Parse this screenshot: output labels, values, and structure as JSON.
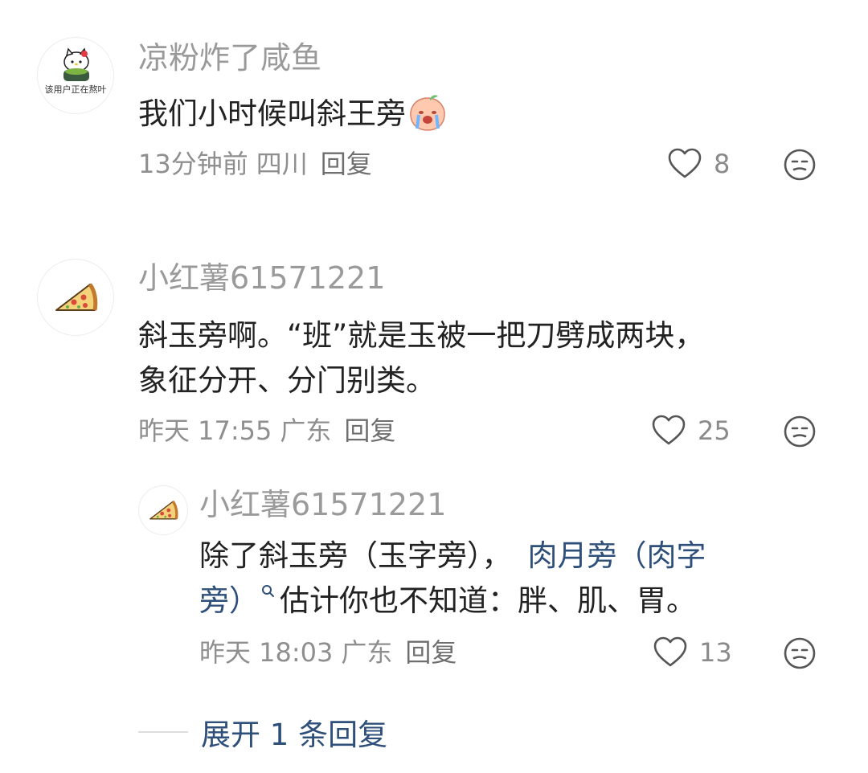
{
  "comments": [
    {
      "avatar_caption": "该用户正在熬叶",
      "username": "凉粉炸了咸鱼",
      "content": "我们小时候叫斜王旁",
      "time": "13分钟前",
      "location": "四川",
      "reply_label": "回复",
      "likes": "8",
      "avatar_icon": "hello-kitty-avatar",
      "emoji_icon": "crying-peach-emoji"
    },
    {
      "username": "小红薯61571221",
      "content_line1": "斜玉旁啊。“班”就是玉被一把刀劈成两块，",
      "content_line2": "象征分开、分门别类。",
      "time": "昨天 17:55",
      "location": "广东",
      "reply_label": "回复",
      "likes": "25",
      "avatar_icon": "pizza-slice-avatar"
    }
  ],
  "reply": {
    "username": "小红薯61571221",
    "content_part1": "除了斜玉旁（玉字旁），",
    "content_link1": "肉月旁（肉字",
    "content_link2": "旁）",
    "content_part2": "估计你也不知道：胖、肌、胃。",
    "time": "昨天 18:03",
    "location": "广东",
    "reply_label": "回复",
    "likes": "13",
    "avatar_icon": "pizza-slice-avatar",
    "search_icon": "search-icon"
  },
  "expand_label": "展开 1 条回复",
  "colors": {
    "link": "#2e4f7a",
    "meta": "#8f8f8f",
    "username": "#9a9a9a"
  }
}
